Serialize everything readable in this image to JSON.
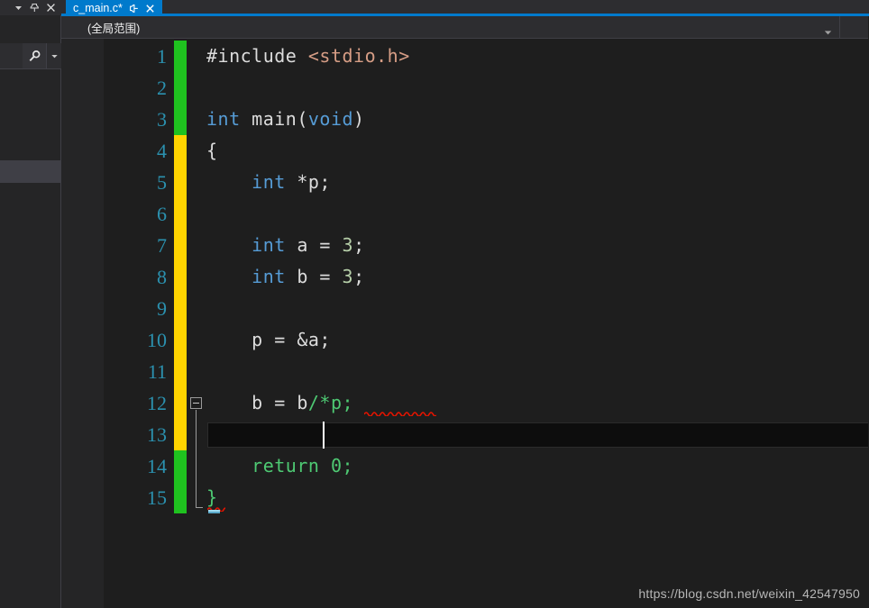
{
  "window": {
    "background": "#1e1e1e",
    "accent": "#007acc"
  },
  "left_panel": {
    "caption_buttons": [
      {
        "name": "dropdown-arrow",
        "label": "▾"
      },
      {
        "name": "pin",
        "label": "Pin"
      },
      {
        "name": "close",
        "label": "×"
      }
    ],
    "search": {
      "icon_name": "search-icon",
      "dropdown_name": "search-dropdown-icon"
    },
    "selected_row_label": ""
  },
  "tab_strip": {
    "active_tab": {
      "title": "c_main.c*",
      "pin_label": "Pin",
      "close_label": "×"
    }
  },
  "nav_bar": {
    "scope_value": "(全局范围)",
    "dropdown_label": "▾"
  },
  "editor": {
    "colors": {
      "line_number": "#2b91af",
      "keyword": "#569cd6",
      "string": "#d69d85",
      "number": "#b5cea8",
      "comment": "#4ec973",
      "plain": "#dcdcdc",
      "change_saved": "#1fc21f",
      "change_unsaved": "#ffd400",
      "error_squiggle": "#e51400"
    },
    "line_numbers": [
      "1",
      "2",
      "3",
      "4",
      "5",
      "6",
      "7",
      "8",
      "9",
      "10",
      "11",
      "12",
      "13",
      "14",
      "15"
    ],
    "lines": [
      {
        "n": 1,
        "tokens": [
          {
            "t": "#include ",
            "c": "plain"
          },
          {
            "t": "<stdio.h>",
            "c": "str"
          }
        ]
      },
      {
        "n": 2,
        "tokens": []
      },
      {
        "n": 3,
        "tokens": [
          {
            "t": "int",
            "c": "kw"
          },
          {
            "t": " main(",
            "c": "plain"
          },
          {
            "t": "void",
            "c": "kw"
          },
          {
            "t": ")",
            "c": "plain"
          }
        ]
      },
      {
        "n": 4,
        "tokens": [
          {
            "t": "{",
            "c": "plain"
          }
        ]
      },
      {
        "n": 5,
        "tokens": [
          {
            "t": "    ",
            "c": "plain"
          },
          {
            "t": "int",
            "c": "kw"
          },
          {
            "t": " *p;",
            "c": "plain"
          }
        ]
      },
      {
        "n": 6,
        "tokens": []
      },
      {
        "n": 7,
        "tokens": [
          {
            "t": "    ",
            "c": "plain"
          },
          {
            "t": "int",
            "c": "kw"
          },
          {
            "t": " a = ",
            "c": "plain"
          },
          {
            "t": "3",
            "c": "num"
          },
          {
            "t": ";",
            "c": "plain"
          }
        ]
      },
      {
        "n": 8,
        "tokens": [
          {
            "t": "    ",
            "c": "plain"
          },
          {
            "t": "int",
            "c": "kw"
          },
          {
            "t": " b = ",
            "c": "plain"
          },
          {
            "t": "3",
            "c": "num"
          },
          {
            "t": ";",
            "c": "plain"
          }
        ]
      },
      {
        "n": 9,
        "tokens": []
      },
      {
        "n": 10,
        "tokens": [
          {
            "t": "    p = &a;",
            "c": "plain"
          }
        ]
      },
      {
        "n": 11,
        "tokens": []
      },
      {
        "n": 12,
        "tokens": [
          {
            "t": "    b = b",
            "c": "plain"
          },
          {
            "t": "/*p;",
            "c": "comment"
          }
        ]
      },
      {
        "n": 13,
        "tokens": []
      },
      {
        "n": 14,
        "tokens": [
          {
            "t": "    return 0;",
            "c": "comment"
          }
        ]
      },
      {
        "n": 15,
        "tokens": [
          {
            "t": "}",
            "c": "comment"
          }
        ]
      }
    ],
    "change_bar_segments": [
      {
        "from_line": 1,
        "to_line": 3,
        "state": "saved",
        "color": "#1fc21f"
      },
      {
        "from_line": 4,
        "to_line": 13,
        "state": "unsaved",
        "color": "#ffd400"
      },
      {
        "from_line": 14,
        "to_line": 15,
        "state": "saved",
        "color": "#1fc21f"
      }
    ],
    "outlining": {
      "collapse_line": 12,
      "collapse_state": "expanded",
      "collapse_glyph": "−"
    },
    "caret": {
      "line": 13,
      "column": 6
    },
    "errors": [
      {
        "line": 12,
        "text": "/*p;"
      },
      {
        "line": 15,
        "text": "}"
      }
    ],
    "smart_tag": {
      "line": 15
    }
  },
  "watermark": {
    "text": "https://blog.csdn.net/weixin_42547950"
  }
}
